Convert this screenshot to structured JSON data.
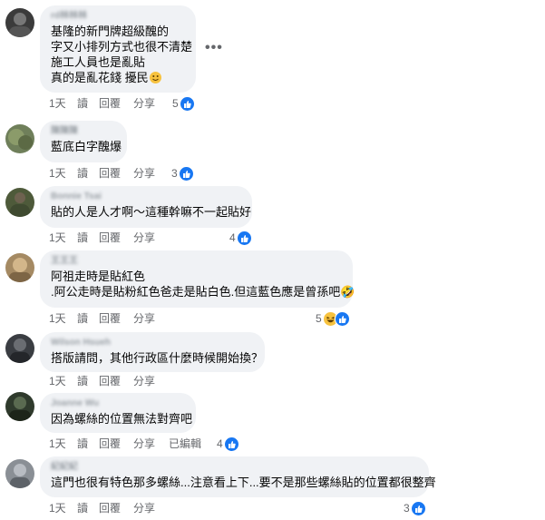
{
  "comments": [
    {
      "author": "rd林林林",
      "lines": [
        "基隆的新門牌超級醜的",
        "字又小排列方式也很不清楚",
        "施工人員也是亂貼",
        "真的是亂花錢 擾民"
      ],
      "time": "1天",
      "read": "讀",
      "reply": "回覆",
      "share": "分享",
      "reaction_count": "5",
      "reactions": [
        "like-icon"
      ],
      "edited": ""
    },
    {
      "author": "陳陳陳",
      "lines": [
        "藍底白字醜爆"
      ],
      "time": "1天",
      "read": "讀",
      "reply": "回覆",
      "share": "分享",
      "reaction_count": "3",
      "reactions": [
        "like-icon"
      ],
      "edited": ""
    },
    {
      "author": "Bonnie Tsai",
      "lines": [
        "貼的人是人才啊～這種幹嘛不一起貼好"
      ],
      "time": "1天",
      "read": "讀",
      "reply": "回覆",
      "share": "分享",
      "reaction_count": "4",
      "reactions": [
        "like-icon"
      ],
      "edited": ""
    },
    {
      "author": "王王王",
      "lines": [
        "阿祖走時是貼紅色",
        ".阿公走時是貼粉紅色爸走是貼白色.但這藍色應是曾孫吧🤣"
      ],
      "time": "1天",
      "read": "讀",
      "reply": "回覆",
      "share": "分享",
      "reaction_count": "5",
      "reactions": [
        "haha-icon",
        "like-icon"
      ],
      "edited": ""
    },
    {
      "author": "Wilson Hsueh",
      "lines": [
        "搭版請問，其他行政區什麼時候開始換？"
      ],
      "time": "1天",
      "read": "讀",
      "reply": "回覆",
      "share": "分享",
      "reaction_count": "",
      "reactions": [],
      "edited": ""
    },
    {
      "author": "Joanne Wu",
      "lines": [
        "因為螺絲的位置無法對齊吧"
      ],
      "time": "1天",
      "read": "讀",
      "reply": "回覆",
      "share": "分享",
      "reaction_count": "4",
      "reactions": [
        "like-icon"
      ],
      "edited": "已編輯"
    },
    {
      "author": "紀紀紀",
      "lines": [
        "這門也很有特色那多螺絲...注意看上下...要不是那些螺絲貼的位置都很整齊"
      ],
      "time": "1天",
      "read": "讀",
      "reply": "回覆",
      "share": "分享",
      "reaction_count": "3",
      "reactions": [
        "like-icon"
      ],
      "edited": ""
    }
  ],
  "more_options": "•••",
  "colors": {
    "bubble": "#f0f2f5",
    "like": "#1877f2",
    "haha": "#f7c23e",
    "meta": "#65676b"
  }
}
